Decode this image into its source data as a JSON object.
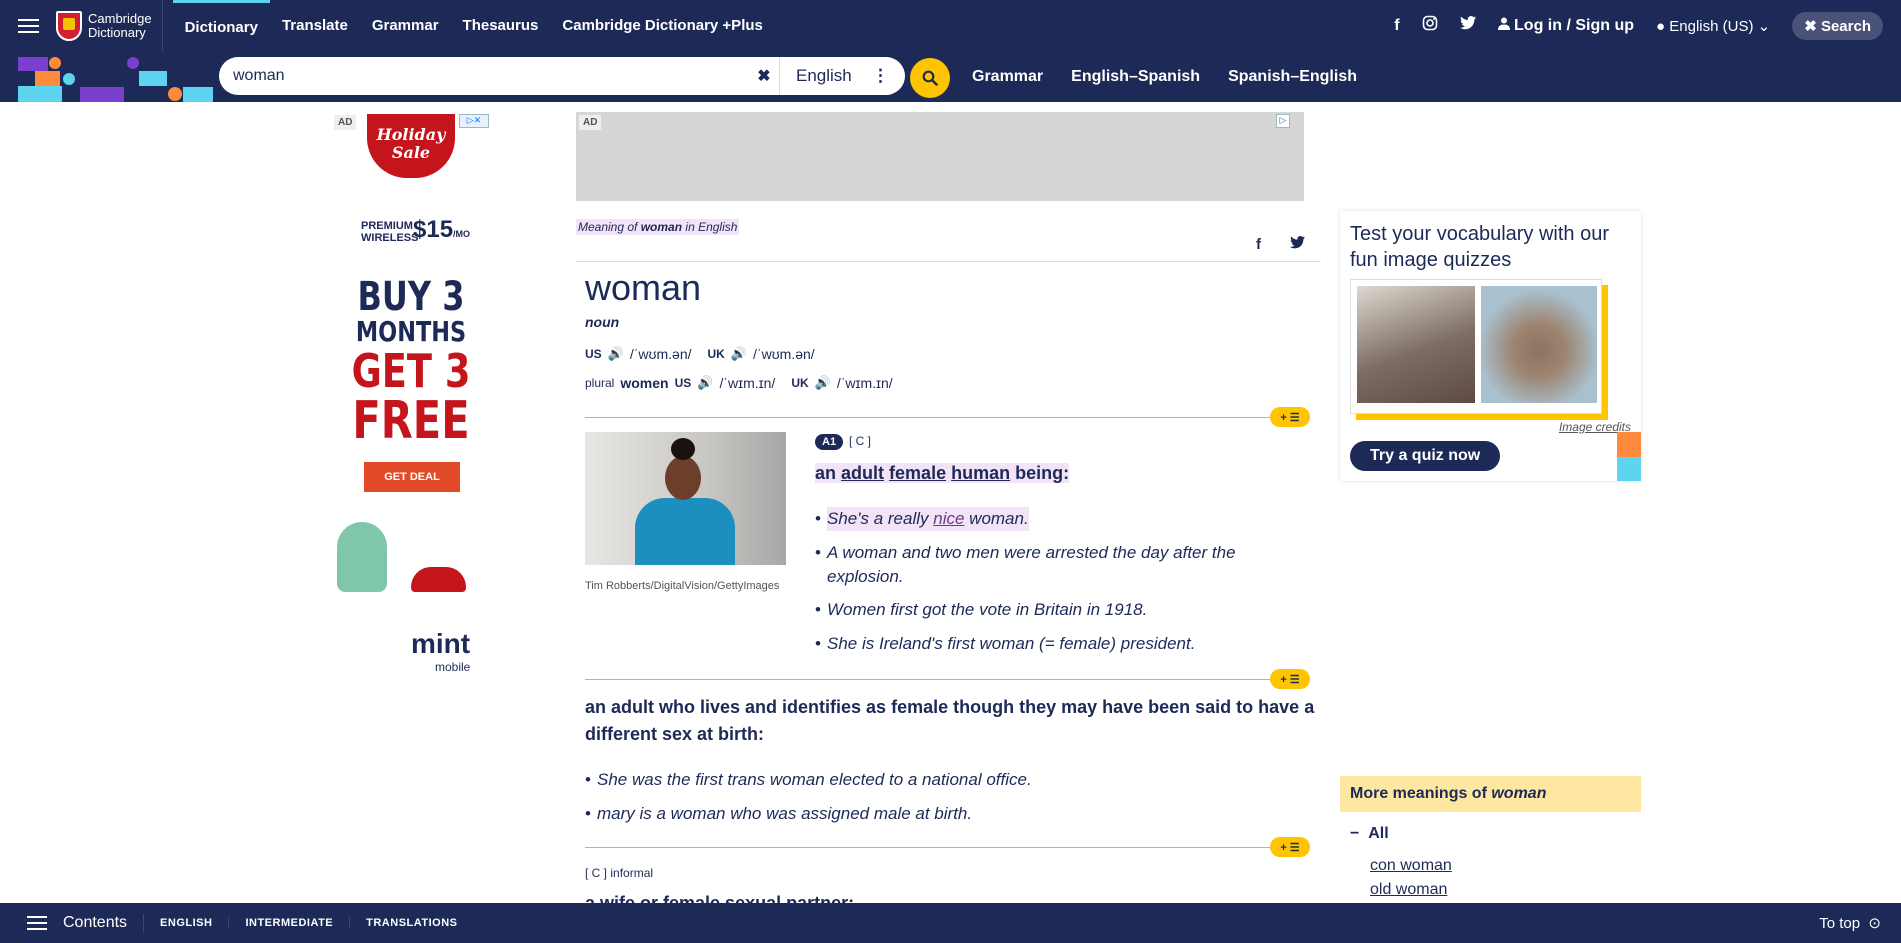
{
  "header": {
    "logo_line1": "Cambridge",
    "logo_line2": "Dictionary",
    "nav": [
      "Dictionary",
      "Translate",
      "Grammar",
      "Thesaurus",
      "Cambridge Dictionary +Plus"
    ],
    "login": "Log in / Sign up",
    "language": "English (US)",
    "search_btn": "Search"
  },
  "search": {
    "query": "woman",
    "dictionary": "English",
    "links": [
      "Grammar",
      "English–Spanish",
      "Spanish–English"
    ]
  },
  "ads": {
    "label": "AD",
    "left_ad": {
      "badge": "Holiday Sale",
      "line1": "PREMIUM WIRELESS",
      "price": "$15",
      "per": "/MO",
      "headline1": "BUY 3",
      "headline2": "MONTHS",
      "headline3": "GET 3",
      "headline4": "FREE",
      "cta": "GET DEAL",
      "brand": "mint",
      "brand_sub": "mobile"
    }
  },
  "entry": {
    "meaning_prefix": "Meaning of ",
    "meaning_word": "woman",
    "meaning_suffix": " in English",
    "headword": "woman",
    "pos": "noun",
    "pron": {
      "us_label": "US",
      "us_ipa": "/ˈwʊm.ən/",
      "uk_label": "UK",
      "uk_ipa": "/ˈwʊm.ən/"
    },
    "plural": {
      "label": "plural",
      "word": "women",
      "us_label": "US",
      "us_ipa": "/ˈwɪm.ɪn/",
      "uk_label": "UK",
      "uk_ipa": "/ˈwɪm.ɪn/"
    },
    "image_credit": "Tim Robberts/DigitalVision/GettyImages",
    "sense1": {
      "level": "A1",
      "grammar": "[ C ]",
      "definition_parts": [
        "an",
        "adult",
        "female",
        "human",
        "being:"
      ],
      "examples": [
        "She's a really nice woman.",
        "A woman and two men were arrested the day after the explosion.",
        "Women first got the vote in Britain in 1918.",
        "She is Ireland's first woman (= female) president."
      ]
    },
    "sense2": {
      "definition": "an adult who lives and identifies as female though they may have been said to have a different sex at birth:",
      "examples": [
        "She was the first trans woman elected to a national office.",
        "mary is a woman who was assigned male at birth."
      ]
    },
    "sense3": {
      "grammar": "[ C ]",
      "register": "informal",
      "definition": "a wife or female sexual partner:"
    },
    "plus_label": "+ ☰"
  },
  "sidebar": {
    "quiz_title": "Test your vocabulary with our fun image quizzes",
    "image_credits": "Image credits",
    "quiz_button": "Try a quiz now",
    "more_prefix": "More meanings of ",
    "more_word": "woman",
    "all_label": "All",
    "more_links": [
      "con woman",
      "old woman"
    ]
  },
  "bottom": {
    "contents": "Contents",
    "tabs": [
      "ENGLISH",
      "INTERMEDIATE",
      "TRANSLATIONS"
    ],
    "to_top": "To top"
  }
}
